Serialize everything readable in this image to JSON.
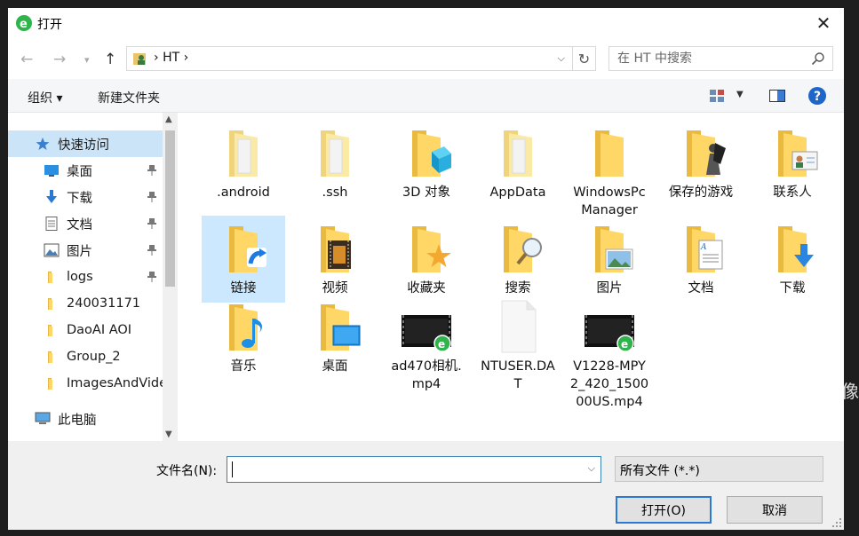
{
  "window": {
    "title": "打开",
    "close_label": "✕"
  },
  "address": {
    "path": "HT"
  },
  "search": {
    "placeholder": "在 HT 中搜索"
  },
  "toolbar": {
    "organize": "组织 ▾",
    "new_folder": "新建文件夹"
  },
  "sidebar": {
    "items": [
      {
        "label": "快速访问",
        "icon": "star-icon",
        "pinned": false
      },
      {
        "label": "桌面",
        "icon": "desktop-icon",
        "pinned": true
      },
      {
        "label": "下载",
        "icon": "download-icon",
        "pinned": true
      },
      {
        "label": "文档",
        "icon": "document-icon",
        "pinned": true
      },
      {
        "label": "图片",
        "icon": "picture-icon",
        "pinned": true
      },
      {
        "label": "logs",
        "icon": "folder-icon",
        "pinned": true
      },
      {
        "label": "240031171",
        "icon": "folder-icon",
        "pinned": false
      },
      {
        "label": "DaoAI AOI",
        "icon": "folder-icon",
        "pinned": false
      },
      {
        "label": "Group_2",
        "icon": "folder-icon",
        "pinned": false
      },
      {
        "label": "ImagesAndVide",
        "icon": "folder-icon",
        "pinned": false
      },
      {
        "label": "此电脑",
        "icon": "computer-icon",
        "pinned": false
      }
    ]
  },
  "files": [
    {
      "name": ".android",
      "icon": "plain-folder-icon"
    },
    {
      "name": ".ssh",
      "icon": "plain-folder-icon"
    },
    {
      "name": "3D 对象",
      "icon": "3d-objects-folder-icon"
    },
    {
      "name": "AppData",
      "icon": "plain-folder-icon"
    },
    {
      "name": "WindowsPcManager",
      "icon": "folder-icon"
    },
    {
      "name": "保存的游戏",
      "icon": "saved-games-folder-icon"
    },
    {
      "name": "联系人",
      "icon": "contacts-folder-icon"
    },
    {
      "name": "链接",
      "icon": "links-folder-icon"
    },
    {
      "name": "视频",
      "icon": "videos-folder-icon"
    },
    {
      "name": "收藏夹",
      "icon": "favorites-folder-icon"
    },
    {
      "name": "搜索",
      "icon": "searches-folder-icon"
    },
    {
      "name": "图片",
      "icon": "pictures-folder-icon"
    },
    {
      "name": "文档",
      "icon": "documents-folder-icon"
    },
    {
      "name": "下载",
      "icon": "downloads-folder-icon"
    },
    {
      "name": "音乐",
      "icon": "music-folder-icon"
    },
    {
      "name": "桌面",
      "icon": "desktop-folder-icon"
    },
    {
      "name": "ad470相机.mp4",
      "icon": "video-file-icon"
    },
    {
      "name": "NTUSER.DAT",
      "icon": "blank-file-icon"
    },
    {
      "name": "V1228-MPY2_420_150000US.mp4",
      "icon": "video-file-icon"
    }
  ],
  "bottom": {
    "filename_label": "文件名(N):",
    "filename_value": "",
    "filter_value": "所有文件 (*.*)",
    "open_label": "打开(O)",
    "cancel_label": "取消"
  },
  "background_fragment": "图像",
  "colors": {
    "accent": "#0078d7",
    "selection": "#cce8ff",
    "folder": "#ffd766"
  }
}
